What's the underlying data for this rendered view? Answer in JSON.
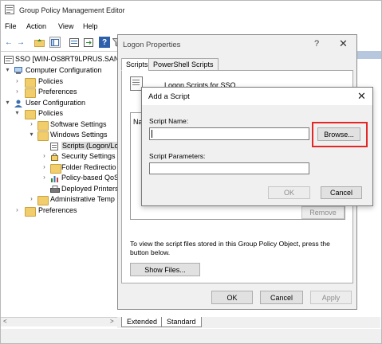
{
  "window": {
    "title": "Group Policy Management Editor"
  },
  "menu": [
    "File",
    "Action",
    "View",
    "Help"
  ],
  "toolbar": {
    "back_glyph": "←",
    "forward_glyph": "→",
    "help_glyph": "?"
  },
  "tree": {
    "items": [
      {
        "label": "SSO [WIN-OS8RT9LPRUS.SANGF",
        "arrow": "",
        "icon": "policy-icon"
      },
      {
        "label": "Computer Configuration",
        "arrow": "▾",
        "icon": "computer-icon"
      },
      {
        "label": "Policies",
        "arrow": "›",
        "icon": "folder-icon"
      },
      {
        "label": "Preferences",
        "arrow": "›",
        "icon": "folder-icon"
      },
      {
        "label": "User Configuration",
        "arrow": "▾",
        "icon": "user-icon"
      },
      {
        "label": "Policies",
        "arrow": "▾",
        "icon": "folder-icon"
      },
      {
        "label": "Software Settings",
        "arrow": "›",
        "icon": "folder-icon"
      },
      {
        "label": "Windows Settings",
        "arrow": "▾",
        "icon": "folder-icon"
      },
      {
        "label": "Scripts (Logon/Lo",
        "arrow": "",
        "icon": "script-icon"
      },
      {
        "label": "Security Settings",
        "arrow": "›",
        "icon": "security-icon"
      },
      {
        "label": "Folder Redirectio",
        "arrow": "›",
        "icon": "folder-icon"
      },
      {
        "label": "Policy-based QoS",
        "arrow": "›",
        "icon": "chart-icon"
      },
      {
        "label": "Deployed Printers",
        "arrow": "",
        "icon": "printer-icon"
      },
      {
        "label": "Administrative Temp",
        "arrow": "›",
        "icon": "folder-icon"
      },
      {
        "label": "Preferences",
        "arrow": "›",
        "icon": "folder-icon"
      }
    ]
  },
  "bottom_tabs": [
    "Extended",
    "Standard"
  ],
  "logon_properties": {
    "title": "Logon Properties",
    "help": "?",
    "close": "✕",
    "tabs": [
      "Scripts",
      "PowerShell Scripts"
    ],
    "heading": "Logon Scripts for SSO",
    "list_label": "Na",
    "remove_label": "Remove",
    "info_text": "To view the script files stored in this Group Policy Object, press the button below.",
    "show_files_label": "Show Files...",
    "ok_label": "OK",
    "cancel_label": "Cancel",
    "apply_label": "Apply"
  },
  "add_script": {
    "title": "Add a Script",
    "close": "✕",
    "script_name_label": "Script Name:",
    "script_name_value": "",
    "browse_label": "Browse...",
    "script_params_label": "Script Parameters:",
    "script_params_value": "",
    "ok_label": "OK",
    "cancel_label": "Cancel",
    "highlight_color": "#e32626"
  }
}
